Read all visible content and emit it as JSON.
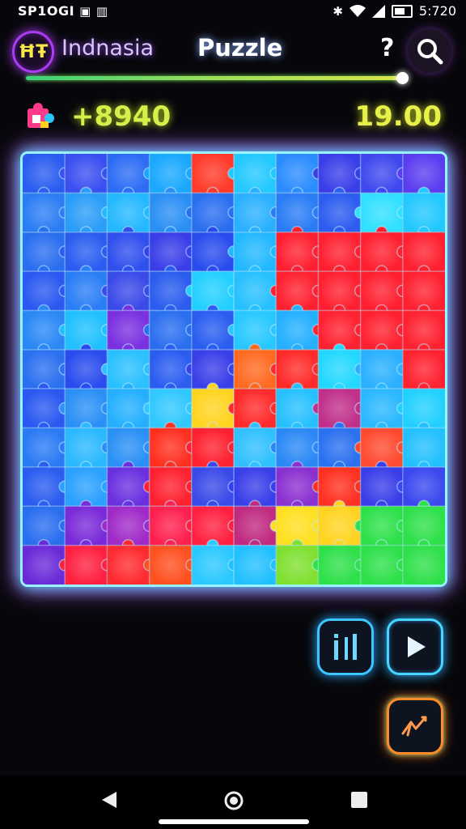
{
  "status_bar": {
    "left_text": "SP1OGI",
    "left_icons": [
      "notification-icon",
      "signal-bars-icon"
    ],
    "right_icons": [
      "bluetooth-icon",
      "wifi-icon",
      "cellular-icon",
      "battery-icon"
    ],
    "time": "5:720"
  },
  "header": {
    "logo_text": "ĦŦ",
    "app_name": "Indnasia",
    "title": "Puzzle",
    "help_label": "?",
    "search_icon": "search-icon"
  },
  "progress": {
    "fraction": 0.95
  },
  "score_row": {
    "score": "+8940",
    "timer": "19.00"
  },
  "board": {
    "rows": 11,
    "cols": 10,
    "grid_colors": [
      [
        "#2a5cf0",
        "#3a4ff0",
        "#2c6cf5",
        "#1aa8ff",
        "#ff3a2a",
        "#22c8ff",
        "#2b8cff",
        "#3a3ee8",
        "#3f48ee",
        "#5b3df0"
      ],
      [
        "#2c7df4",
        "#2a9df8",
        "#24b8ff",
        "#2a8ff5",
        "#2a6ef0",
        "#2ab0ff",
        "#2a7cf5",
        "#2c5cf0",
        "#30e0ff",
        "#22c8ff"
      ],
      [
        "#2a6ef0",
        "#2a5cf0",
        "#2f4fee",
        "#3a3ee8",
        "#2a4cee",
        "#22b8ff",
        "#ff1f30",
        "#ff1f30",
        "#ff1f30",
        "#ff2030"
      ],
      [
        "#2a58f0",
        "#2a7ef5",
        "#3a4ae8",
        "#2a5cee",
        "#22d0ff",
        "#26c0ff",
        "#ff2030",
        "#ff1f30",
        "#ff1f30",
        "#ff2030"
      ],
      [
        "#2a88f5",
        "#1fc0ff",
        "#7a30e0",
        "#2a6ef0",
        "#2a5cf0",
        "#26c8ff",
        "#24b0ff",
        "#ff2030",
        "#ff2030",
        "#ff2030"
      ],
      [
        "#2a70f0",
        "#2a4cee",
        "#2ac0ff",
        "#2a5cf0",
        "#3a3ee8",
        "#ff6a20",
        "#ff2a2a",
        "#22d8ff",
        "#2ab0ff",
        "#ff2030"
      ],
      [
        "#2a58f0",
        "#2a90f5",
        "#24b0ff",
        "#30c8ff",
        "#ffd420",
        "#ff2a2a",
        "#26c0ff",
        "#c0308a",
        "#2ab8ff",
        "#22d0ff"
      ],
      [
        "#2a7af5",
        "#2ab8ff",
        "#2a90f5",
        "#ff3020",
        "#ff2030",
        "#30c0ff",
        "#2a88f5",
        "#2a70f0",
        "#ff4a30",
        "#22c0ff"
      ],
      [
        "#2a5cf0",
        "#2aa0ff",
        "#6a30e0",
        "#ff2030",
        "#3a4ae8",
        "#3a3ee8",
        "#8a30d0",
        "#ff3020",
        "#3a3ee8",
        "#3a48ee"
      ],
      [
        "#2a6ef0",
        "#7a2ad8",
        "#a02ac8",
        "#ff2050",
        "#ff2040",
        "#c02a80",
        "#ffe020",
        "#ffd420",
        "#2ee04a",
        "#2ee04a"
      ],
      [
        "#6a2ad8",
        "#ff2040",
        "#ff2a30",
        "#ff5020",
        "#2ac8ff",
        "#22c0ff",
        "#80e030",
        "#2ee04a",
        "#2ee04a",
        "#2ee04a"
      ]
    ]
  },
  "actions": {
    "stats_icon": "bar-stats-icon",
    "play_icon": "play-icon",
    "magic_icon": "wand-icon"
  },
  "nav": {
    "back_icon": "back-triangle-icon",
    "home_icon": "home-circle-icon",
    "recent_icon": "recent-square-icon"
  },
  "colors": {
    "background": "#07070b",
    "score": "#d7ef4a",
    "timer": "#e8f04a",
    "board_glow": "#4fd3ff",
    "accent_purple": "#a93cf0"
  }
}
